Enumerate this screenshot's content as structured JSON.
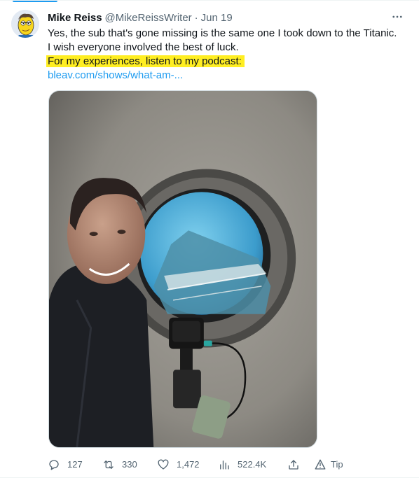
{
  "author": {
    "name": "Mike Reiss",
    "handle": "@MikeReissWriter",
    "separator": "·",
    "date": "Jun 19"
  },
  "tweet": {
    "line1": "Yes, the sub that's gone missing is the same one I took down to the Titanic.",
    "line2": "I wish everyone involved the best of luck.",
    "highlighted_line": "For my experiences, listen to my podcast:",
    "link_text": "bleav.com/shows/what-am-...",
    "highlight_color": "#ffee22",
    "link_color": "#1d9bf0"
  },
  "media": {
    "kind": "photo",
    "subject": "selfie-at-submarine-porthole"
  },
  "actions": {
    "replies": "127",
    "retweets": "330",
    "likes": "1,472",
    "views": "522.4K",
    "tip_label": "Tip"
  },
  "icons": {
    "more": "more-icon",
    "reply": "reply-icon",
    "retweet": "retweet-icon",
    "like": "heart-icon",
    "views": "views-icon",
    "share": "share-icon",
    "tip": "tip-icon"
  },
  "colors": {
    "text": "#0f1419",
    "secondary": "#536471",
    "accent": "#1d9bf0"
  }
}
